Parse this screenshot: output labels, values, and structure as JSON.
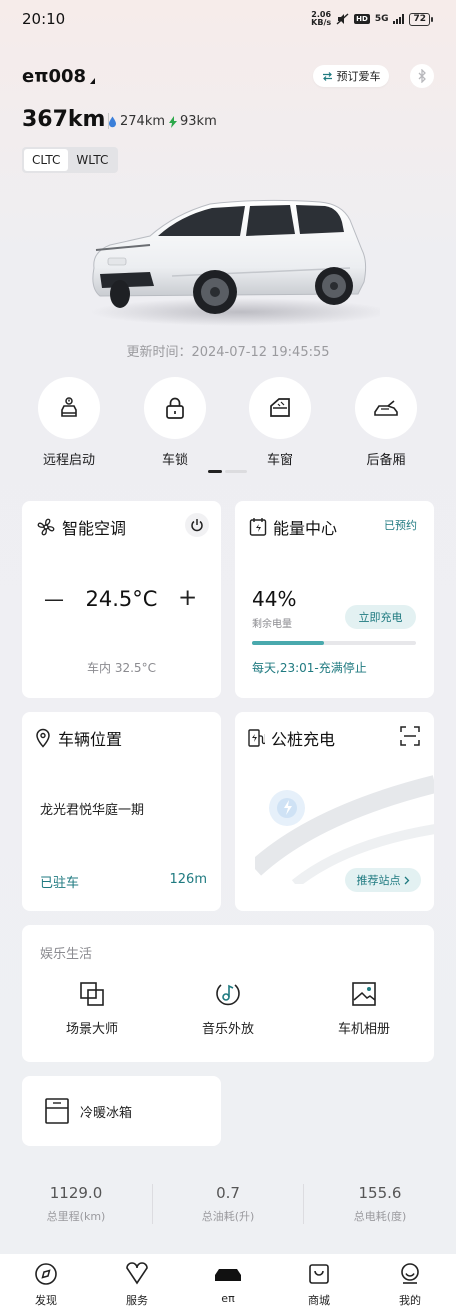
{
  "status_bar": {
    "time": "20:10",
    "net_speed_value": "2.06",
    "net_speed_unit": "KB/s",
    "hd_label": "HD",
    "network": "5G",
    "battery": "72"
  },
  "header": {
    "car_name": "eπ008",
    "reserve_button": "预订爱车",
    "range_total": "367km",
    "range_fuel": "274km",
    "range_electric": "93km",
    "modes": [
      "CLTC",
      "WLTC"
    ],
    "active_mode": "CLTC",
    "car_badge": "eπ008",
    "updated_at": "更新时间：2024-07-12 19:45:55"
  },
  "quick_actions": [
    {
      "label": "远程启动",
      "icon": "remote-start-icon"
    },
    {
      "label": "车锁",
      "icon": "lock-icon"
    },
    {
      "label": "车窗",
      "icon": "window-icon"
    },
    {
      "label": "后备厢",
      "icon": "trunk-icon"
    }
  ],
  "climate": {
    "title": "智能空调",
    "temperature": "24.5°C",
    "minus": "—",
    "plus": "+",
    "inside_temp": "车内 32.5°C"
  },
  "energy": {
    "title": "能量中心",
    "status": "已预约",
    "percent": "44%",
    "percent_value": 0.44,
    "remaining_label": "剩余电量",
    "charge_button": "立即充电",
    "schedule": "每天,23:01-充满停止"
  },
  "location": {
    "title": "车辆位置",
    "address": "龙光君悦华庭一期",
    "parked_status": "已驻车",
    "distance": "126m"
  },
  "public_charging": {
    "title": "公桩充电",
    "recommend_button": "推荐站点"
  },
  "entertainment": {
    "section_label": "娱乐生活",
    "items": [
      {
        "label": "场景大师",
        "icon": "scene-master-icon"
      },
      {
        "label": "音乐外放",
        "icon": "music-icon"
      },
      {
        "label": "车机相册",
        "icon": "photo-album-icon"
      }
    ]
  },
  "fridge": {
    "label": "冷暖冰箱"
  },
  "stats": [
    {
      "value": "1129.0",
      "label": "总里程(km)"
    },
    {
      "value": "0.7",
      "label": "总油耗(升)"
    },
    {
      "value": "155.6",
      "label": "总电耗(度)"
    }
  ],
  "bottom_nav": [
    {
      "label": "发现",
      "icon": "discover-icon"
    },
    {
      "label": "服务",
      "icon": "service-icon"
    },
    {
      "label": "eπ",
      "icon": "car-icon"
    },
    {
      "label": "商城",
      "icon": "shop-icon"
    },
    {
      "label": "我的",
      "icon": "profile-icon"
    }
  ],
  "colors": {
    "accent": "#1f7a80",
    "progress": "#49a9ad",
    "bolt": "#2ca84a",
    "drop": "#3b7fd9"
  }
}
